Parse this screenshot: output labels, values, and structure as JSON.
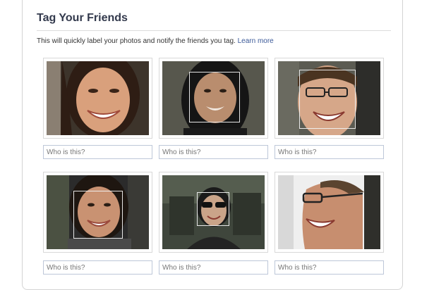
{
  "dialog": {
    "title": "Tag Your Friends",
    "description": "This will quickly label your photos and notify the friends you tag.",
    "learn_more": "Learn more"
  },
  "photos": [
    {
      "placeholder": "Who is this?"
    },
    {
      "placeholder": "Who is this?"
    },
    {
      "placeholder": "Who is this?"
    },
    {
      "placeholder": "Who is this?"
    },
    {
      "placeholder": "Who is this?"
    },
    {
      "placeholder": "Who is this?"
    }
  ],
  "colors": {
    "title": "#333a4d",
    "link": "#3b5998",
    "input_border": "#bdc7d8",
    "placeholder": "#777777"
  }
}
